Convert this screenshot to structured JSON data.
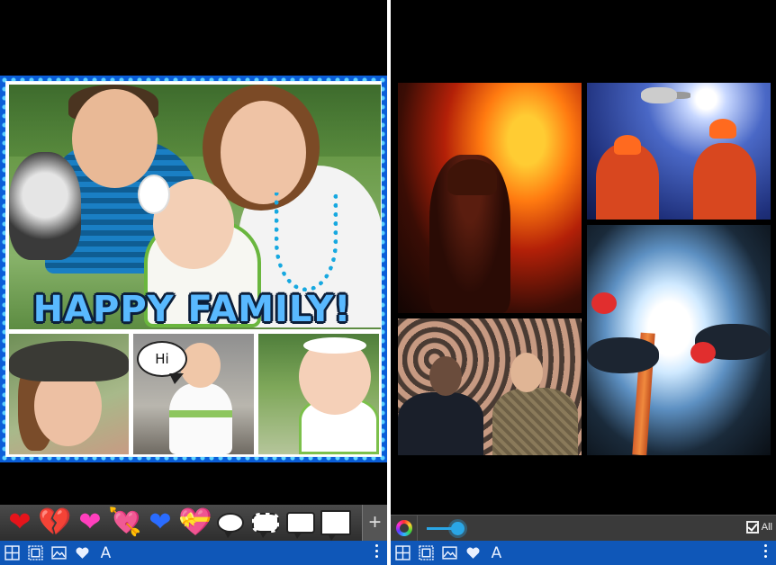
{
  "left": {
    "caption": "HAPPY FAMILY!",
    "speech_bubble_text": "Hi",
    "frame_color": "#0b5ed8",
    "caption_color": "#59b9ff",
    "stickers": [
      {
        "icon": "red-heart-icon",
        "glyph": "❤",
        "color": "#e5141b"
      },
      {
        "icon": "broken-heart-icon",
        "glyph": "💔",
        "color": "#c81018"
      },
      {
        "icon": "pink-heart-icon",
        "glyph": "❤",
        "color": "#ff3fbd"
      },
      {
        "icon": "heart-arrow-icon",
        "glyph": "💘",
        "color": "#ff4fa0"
      },
      {
        "icon": "blue-heart-icon",
        "glyph": "❤",
        "color": "#2a6cff"
      },
      {
        "icon": "gift-heart-icon",
        "glyph": "💝",
        "color": "#ff66c4"
      }
    ],
    "add_label": "+"
  },
  "right": {
    "all_label": "All",
    "slider_color": "#2aa6e6"
  },
  "toolbar": {
    "text_tool_label": "A",
    "color": "#0f57b8"
  }
}
